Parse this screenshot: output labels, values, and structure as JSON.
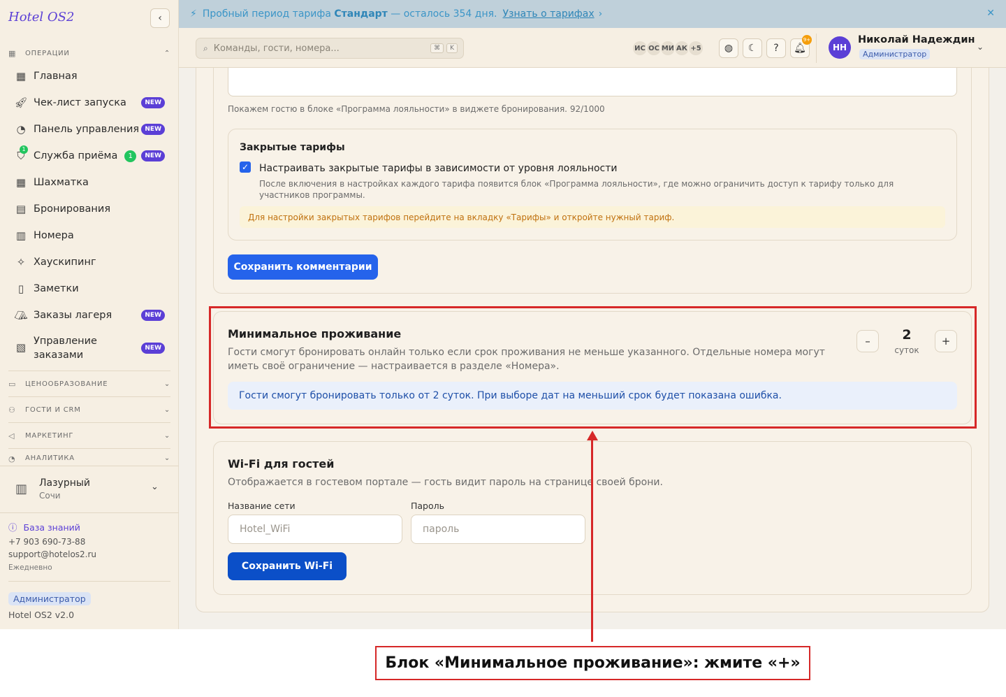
{
  "sidebar": {
    "brand": "Hotel OS2",
    "sections": {
      "operations": "ОПЕРАЦИИ",
      "pricing": "ЦЕНООБРАЗОВАНИЕ",
      "guests": "ГОСТИ И CRM",
      "marketing": "МАРКЕТИНГ",
      "analytics": "АНАЛИТИКА"
    },
    "items": [
      {
        "label": "Главная"
      },
      {
        "label": "Чек-лист запуска",
        "badge": "NEW"
      },
      {
        "label": "Панель управления",
        "badge": "NEW"
      },
      {
        "label": "Служба приёма",
        "badge": "NEW",
        "count": "1",
        "dot": "1"
      },
      {
        "label": "Шахматка"
      },
      {
        "label": "Бронирования"
      },
      {
        "label": "Номера"
      },
      {
        "label": "Хаускипинг"
      },
      {
        "label": "Заметки"
      },
      {
        "label": "Заказы лагеря",
        "badge": "NEW"
      },
      {
        "label_line1": "Управление",
        "label_line2": "заказами",
        "badge": "NEW"
      }
    ],
    "hotel": {
      "name": "Лазурный",
      "city": "Сочи"
    },
    "footer": {
      "kb": "База знаний",
      "phone": "+7 903 690-73-88",
      "email": "support@hotelos2.ru",
      "schedule": "Ежедневно",
      "role": "Администратор",
      "version": "Hotel OS2 v2.0"
    }
  },
  "banner": {
    "prefix": "Пробный период тарифа",
    "plan": "Стандарт",
    "suffix": "— осталось 354 дня.",
    "link": "Узнать о тарифах",
    "link_arrow": "›",
    "close": "✕"
  },
  "topbar": {
    "search_placeholder": "Команды, гости, номера...",
    "key1": "⌘",
    "key2": "K",
    "avatars": [
      "ИС",
      "ОС",
      "МИ",
      "АК",
      "+5"
    ],
    "notif_badge": "9+",
    "user_initials": "НН",
    "user_name": "Николай Надеждин",
    "user_role": "Администратор"
  },
  "loyalty": {
    "hint": "Покажем гостю в блоке «Программа лояльности» в виджете бронирования. 92/1000",
    "closed_title": "Закрытые тарифы",
    "checkbox_label": "Настраивать закрытые тарифы в зависимости от уровня лояльности",
    "checkbox_desc": "После включения в настройках каждого тарифа появится блок «Программа лояльности», где можно ограничить доступ к тарифу только для участников программы.",
    "warning": "Для настройки закрытых тарифов перейдите на вкладку «Тарифы» и откройте нужный тариф.",
    "save_button": "Сохранить комментарии"
  },
  "min_stay": {
    "title": "Минимальное проживание",
    "description": "Гости смогут бронировать онлайн только если срок проживания не меньше указанного. Отдельные номера могут иметь своё ограничение — настраивается в разделе «Номера».",
    "minus": "–",
    "value": "2",
    "unit": "суток",
    "plus": "+",
    "info": "Гости смогут бронировать только от 2 суток. При выборе дат на меньший срок будет показана ошибка."
  },
  "wifi": {
    "title": "Wi-Fi для гостей",
    "description": "Отображается в гостевом портале — гость видит пароль на странице своей брони.",
    "network_label": "Название сети",
    "network_placeholder": "Hotel_WiFi",
    "password_label": "Пароль",
    "password_placeholder": "пароль",
    "save_button": "Сохранить Wi-Fi"
  },
  "annotation": {
    "caption": "Блок «Минимальное проживание»: жмите «+»",
    "color": "#d62828"
  }
}
